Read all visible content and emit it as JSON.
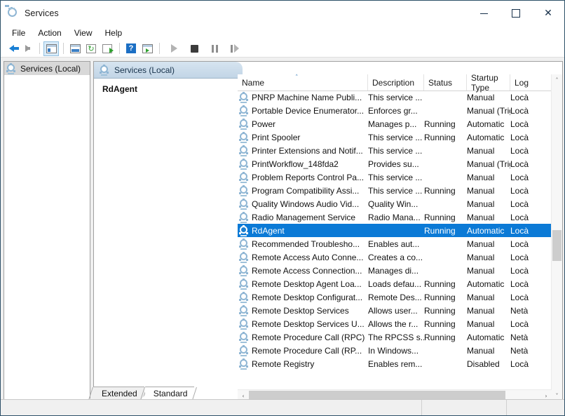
{
  "window": {
    "title": "Services",
    "icon": "services-gear-icon",
    "controls": {
      "minimize": "—",
      "maximize": "□",
      "close": "✕"
    }
  },
  "menubar": {
    "items": [
      {
        "label": "File"
      },
      {
        "label": "Action"
      },
      {
        "label": "View"
      },
      {
        "label": "Help"
      }
    ]
  },
  "toolbar": {
    "buttons": [
      {
        "name": "back-arrow-icon",
        "label": "Back",
        "enabled": true
      },
      {
        "name": "forward-arrow-icon",
        "label": "Forward",
        "enabled": false
      },
      {
        "name": "show-hide-tree-icon",
        "label": "Show/Hide Console Tree",
        "pressed": true
      },
      {
        "name": "properties-icon",
        "label": "Properties"
      },
      {
        "name": "refresh-icon",
        "label": "Refresh"
      },
      {
        "name": "export-list-icon",
        "label": "Export List"
      },
      {
        "name": "help-icon",
        "label": "Help"
      },
      {
        "name": "show-action-pane-icon",
        "label": "Show Action Pane"
      },
      {
        "name": "start-service-icon",
        "label": "Start Service",
        "enabled": false
      },
      {
        "name": "stop-service-icon",
        "label": "Stop Service",
        "enabled": true
      },
      {
        "name": "pause-service-icon",
        "label": "Pause Service",
        "enabled": false
      },
      {
        "name": "restart-service-icon",
        "label": "Restart Service",
        "enabled": false
      }
    ]
  },
  "tree": {
    "root": {
      "label": "Services (Local)",
      "icon": "services-gear-icon",
      "selected": true
    }
  },
  "pane": {
    "header": "Services (Local)",
    "detail_title": "RdAgent"
  },
  "list": {
    "columns": [
      {
        "key": "name",
        "label": "Name",
        "sorted": "asc",
        "sort_glyph": "˄"
      },
      {
        "key": "description",
        "label": "Description"
      },
      {
        "key": "status",
        "label": "Status"
      },
      {
        "key": "startup",
        "label": "Startup Type"
      },
      {
        "key": "logon",
        "label": "Log"
      }
    ],
    "rows": [
      {
        "name": "PNRP Machine Name Publi...",
        "description": "This service ...",
        "status": "",
        "startup": "Manual",
        "logon": "Locà",
        "selected": false
      },
      {
        "name": "Portable Device Enumerator...",
        "description": "Enforces gr...",
        "status": "",
        "startup": "Manual (Trig...",
        "logon": "Locà",
        "selected": false
      },
      {
        "name": "Power",
        "description": "Manages p...",
        "status": "Running",
        "startup": "Automatic",
        "logon": "Locà",
        "selected": false
      },
      {
        "name": "Print Spooler",
        "description": "This service ...",
        "status": "Running",
        "startup": "Automatic",
        "logon": "Locà",
        "selected": false
      },
      {
        "name": "Printer Extensions and Notif...",
        "description": "This service ...",
        "status": "",
        "startup": "Manual",
        "logon": "Locà",
        "selected": false
      },
      {
        "name": "PrintWorkflow_148fda2",
        "description": "Provides su...",
        "status": "",
        "startup": "Manual (Trig...",
        "logon": "Locà",
        "selected": false
      },
      {
        "name": "Problem Reports Control Pa...",
        "description": "This service ...",
        "status": "",
        "startup": "Manual",
        "logon": "Locà",
        "selected": false
      },
      {
        "name": "Program Compatibility Assi...",
        "description": "This service ...",
        "status": "Running",
        "startup": "Manual",
        "logon": "Locà",
        "selected": false
      },
      {
        "name": "Quality Windows Audio Vid...",
        "description": "Quality Win...",
        "status": "",
        "startup": "Manual",
        "logon": "Locà",
        "selected": false
      },
      {
        "name": "Radio Management Service",
        "description": "Radio Mana...",
        "status": "Running",
        "startup": "Manual",
        "logon": "Locà",
        "selected": false
      },
      {
        "name": "RdAgent",
        "description": "",
        "status": "Running",
        "startup": "Automatic",
        "logon": "Locà",
        "selected": true
      },
      {
        "name": "Recommended Troublesho...",
        "description": "Enables aut...",
        "status": "",
        "startup": "Manual",
        "logon": "Locà",
        "selected": false
      },
      {
        "name": "Remote Access Auto Conne...",
        "description": "Creates a co...",
        "status": "",
        "startup": "Manual",
        "logon": "Locà",
        "selected": false
      },
      {
        "name": "Remote Access Connection...",
        "description": "Manages di...",
        "status": "",
        "startup": "Manual",
        "logon": "Locà",
        "selected": false
      },
      {
        "name": "Remote Desktop Agent Loa...",
        "description": "Loads defau...",
        "status": "Running",
        "startup": "Automatic",
        "logon": "Locà",
        "selected": false
      },
      {
        "name": "Remote Desktop Configurat...",
        "description": "Remote Des...",
        "status": "Running",
        "startup": "Manual",
        "logon": "Locà",
        "selected": false
      },
      {
        "name": "Remote Desktop Services",
        "description": "Allows user...",
        "status": "Running",
        "startup": "Manual",
        "logon": "Netà",
        "selected": false
      },
      {
        "name": "Remote Desktop Services U...",
        "description": "Allows the r...",
        "status": "Running",
        "startup": "Manual",
        "logon": "Locà",
        "selected": false
      },
      {
        "name": "Remote Procedure Call (RPC)",
        "description": "The RPCSS s...",
        "status": "Running",
        "startup": "Automatic",
        "logon": "Netà",
        "selected": false
      },
      {
        "name": "Remote Procedure Call (RP...",
        "description": "In Windows...",
        "status": "",
        "startup": "Manual",
        "logon": "Netà",
        "selected": false
      },
      {
        "name": "Remote Registry",
        "description": "Enables rem...",
        "status": "",
        "startup": "Disabled",
        "logon": "Locà",
        "selected": false
      }
    ]
  },
  "scrollbars": {
    "vertical": {
      "up_glyph": "˄",
      "down_glyph": "˅"
    },
    "horizontal": {
      "left_glyph": "‹",
      "right_glyph": "›"
    }
  },
  "tabs": [
    {
      "label": "Extended",
      "active": false
    },
    {
      "label": "Standard",
      "active": true
    }
  ],
  "colors": {
    "selection": "#0b7ad6",
    "title_bar": "#ffffff",
    "pane_header": "#c9dbea",
    "window_border": "#2d5068"
  }
}
